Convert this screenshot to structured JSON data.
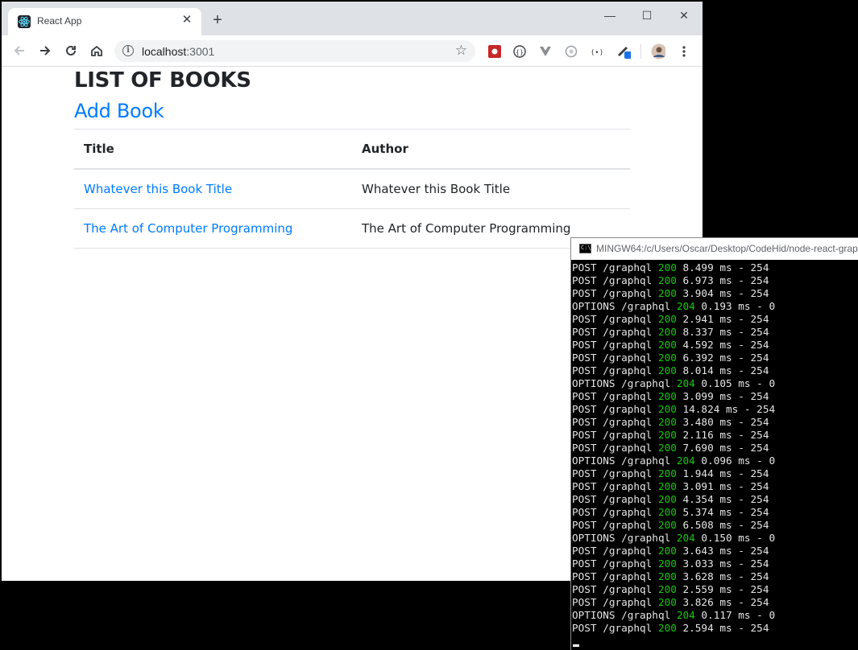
{
  "browser": {
    "tab_title": "React App",
    "tab_close": "✕",
    "new_tab": "+",
    "url_host": "localhost",
    "url_port": ":3001",
    "window_controls": {
      "minimize": "—",
      "maximize": "☐",
      "close": "✕"
    }
  },
  "page": {
    "heading": "LIST OF BOOKS",
    "add_link": "Add Book",
    "table": {
      "headers": [
        "Title",
        "Author"
      ],
      "rows": [
        {
          "title": "Whatever this Book Title",
          "author": "Whatever this Book Title"
        },
        {
          "title": "The Art of Computer Programming",
          "author": "The Art of Computer Programming"
        }
      ]
    },
    "link_color": "#007bff"
  },
  "terminal": {
    "title": "MINGW64:/c/Users/Oscar/Desktop/CodeHid/node-react-grap",
    "status_color": "#16c60c",
    "lines": [
      {
        "pre": "POST /graphql ",
        "status": "200",
        "post": " 8.499 ms - 254"
      },
      {
        "pre": "POST /graphql ",
        "status": "200",
        "post": " 6.973 ms - 254"
      },
      {
        "pre": "POST /graphql ",
        "status": "200",
        "post": " 3.904 ms - 254"
      },
      {
        "pre": "OPTIONS /graphql ",
        "status": "204",
        "post": " 0.193 ms - 0"
      },
      {
        "pre": "POST /graphql ",
        "status": "200",
        "post": " 2.941 ms - 254"
      },
      {
        "pre": "POST /graphql ",
        "status": "200",
        "post": " 8.337 ms - 254"
      },
      {
        "pre": "POST /graphql ",
        "status": "200",
        "post": " 4.592 ms - 254"
      },
      {
        "pre": "POST /graphql ",
        "status": "200",
        "post": " 6.392 ms - 254"
      },
      {
        "pre": "POST /graphql ",
        "status": "200",
        "post": " 8.014 ms - 254"
      },
      {
        "pre": "OPTIONS /graphql ",
        "status": "204",
        "post": " 0.105 ms - 0"
      },
      {
        "pre": "POST /graphql ",
        "status": "200",
        "post": " 3.099 ms - 254"
      },
      {
        "pre": "POST /graphql ",
        "status": "200",
        "post": " 14.824 ms - 254"
      },
      {
        "pre": "POST /graphql ",
        "status": "200",
        "post": " 3.480 ms - 254"
      },
      {
        "pre": "POST /graphql ",
        "status": "200",
        "post": " 2.116 ms - 254"
      },
      {
        "pre": "POST /graphql ",
        "status": "200",
        "post": " 7.690 ms - 254"
      },
      {
        "pre": "OPTIONS /graphql ",
        "status": "204",
        "post": " 0.096 ms - 0"
      },
      {
        "pre": "POST /graphql ",
        "status": "200",
        "post": " 1.944 ms - 254"
      },
      {
        "pre": "POST /graphql ",
        "status": "200",
        "post": " 3.091 ms - 254"
      },
      {
        "pre": "POST /graphql ",
        "status": "200",
        "post": " 4.354 ms - 254"
      },
      {
        "pre": "POST /graphql ",
        "status": "200",
        "post": " 5.374 ms - 254"
      },
      {
        "pre": "POST /graphql ",
        "status": "200",
        "post": " 6.508 ms - 254"
      },
      {
        "pre": "OPTIONS /graphql ",
        "status": "204",
        "post": " 0.150 ms - 0"
      },
      {
        "pre": "POST /graphql ",
        "status": "200",
        "post": " 3.643 ms - 254"
      },
      {
        "pre": "POST /graphql ",
        "status": "200",
        "post": " 3.033 ms - 254"
      },
      {
        "pre": "POST /graphql ",
        "status": "200",
        "post": " 3.628 ms - 254"
      },
      {
        "pre": "POST /graphql ",
        "status": "200",
        "post": " 2.559 ms - 254"
      },
      {
        "pre": "POST /graphql ",
        "status": "200",
        "post": " 3.826 ms - 254"
      },
      {
        "pre": "OPTIONS /graphql ",
        "status": "204",
        "post": " 0.117 ms - 0"
      },
      {
        "pre": "POST /graphql ",
        "status": "200",
        "post": " 2.594 ms - 254"
      }
    ]
  }
}
